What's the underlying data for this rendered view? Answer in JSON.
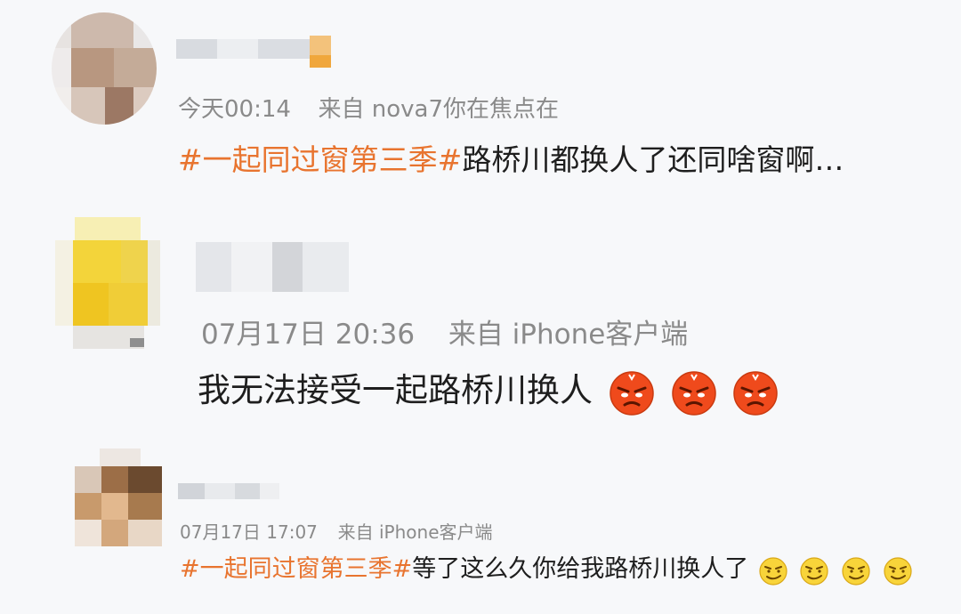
{
  "comments": [
    {
      "avatar": "blurred-avatar",
      "meta": {
        "time": "今天00:14",
        "source_prefix": "来自",
        "source": "nova7你在焦点在"
      },
      "body": {
        "hashtag": "#一起同过窗第三季#",
        "text": "路桥川都换人了还同啥窗啊…",
        "emojis": []
      }
    },
    {
      "avatar": "blurred-avatar",
      "meta": {
        "time": "07月17日 20:36",
        "source_prefix": "来自",
        "source": "iPhone客户端"
      },
      "body": {
        "hashtag": "",
        "text": "我无法接受一起路桥川换人",
        "emojis": [
          "angry-face-icon",
          "angry-face-icon",
          "angry-face-icon"
        ]
      }
    },
    {
      "avatar": "blurred-avatar",
      "meta": {
        "time": "07月17日 17:07",
        "source_prefix": "来自",
        "source": "iPhone客户端"
      },
      "body": {
        "hashtag": "#一起同过窗第三季#",
        "text": "等了这么久你给我路桥川换人了",
        "emojis": [
          "smirk-face-icon",
          "smirk-face-icon",
          "smirk-face-icon",
          "smirk-face-icon"
        ]
      }
    }
  ],
  "colors": {
    "hashtag": "#e8742f",
    "meta": "#8a8a8a",
    "text": "#1e1e1e",
    "background": "#f7f8fa"
  }
}
